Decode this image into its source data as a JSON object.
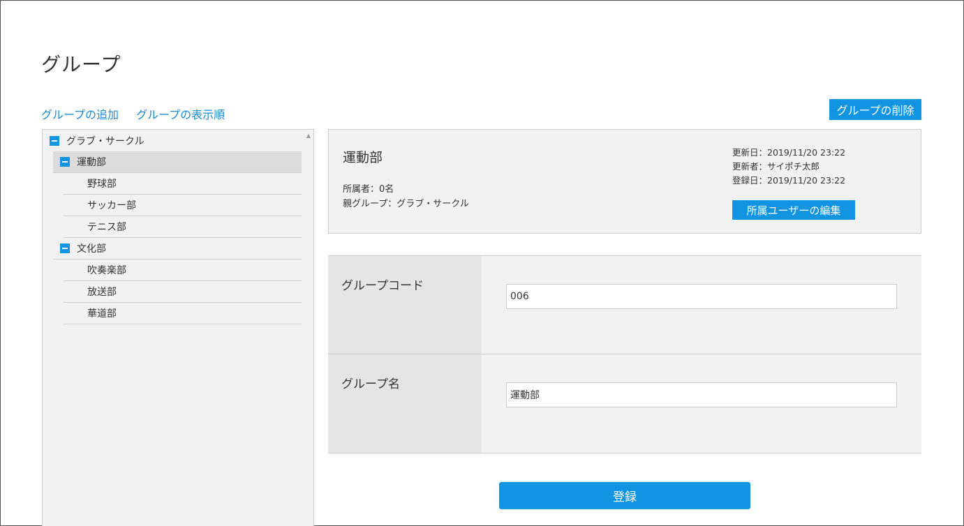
{
  "page": {
    "title": "グループ"
  },
  "links": {
    "add_group": "グループの追加",
    "display_order": "グループの表示順"
  },
  "buttons": {
    "delete_group": "グループの削除",
    "edit_members": "所属ユーザーの編集",
    "submit": "登録"
  },
  "tree": {
    "root": "グラブ・サークル",
    "groups": [
      {
        "label": "運動部",
        "children": [
          "野球部",
          "サッカー部",
          "テニス部"
        ],
        "selected": true
      },
      {
        "label": "文化部",
        "children": [
          "吹奏楽部",
          "放送部",
          "華道部"
        ],
        "selected": false
      }
    ]
  },
  "info": {
    "name": "運動部",
    "members": "所属者：0名",
    "parent": "親グループ：グラブ・サークル",
    "updated_date": "更新日：2019/11/20 23:22",
    "updated_by": "更新者：サイポチ太郎",
    "registered_date": "登録日：2019/11/20 23:22"
  },
  "form": {
    "code_label": "グループコード",
    "code_value": "006",
    "name_label": "グループ名",
    "name_value": "運動部"
  },
  "colors": {
    "accent": "#1195e2",
    "link": "#1a8bd6",
    "panel_bg": "#f2f2f2",
    "label_bg": "#e5e5e5",
    "selected_row": "#dcdcdc"
  }
}
